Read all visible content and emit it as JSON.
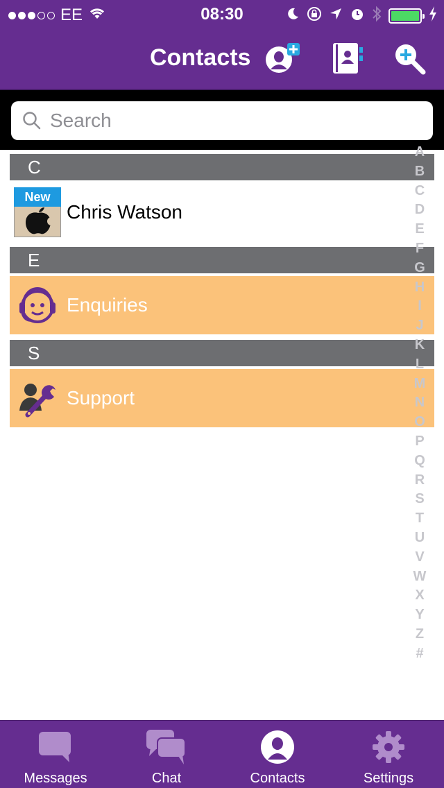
{
  "status_bar": {
    "carrier": "EE",
    "time": "08:30"
  },
  "nav": {
    "title": "Contacts"
  },
  "search": {
    "placeholder": "Search"
  },
  "sections": [
    {
      "letter": "C",
      "contacts": [
        {
          "name": "Chris Watson",
          "badge": "New"
        }
      ]
    },
    {
      "letter": "E",
      "contacts": [
        {
          "name": "Enquiries"
        }
      ]
    },
    {
      "letter": "S",
      "contacts": [
        {
          "name": "Support"
        }
      ]
    }
  ],
  "index_letters": [
    "A",
    "B",
    "C",
    "D",
    "E",
    "F",
    "G",
    "H",
    "I",
    "J",
    "K",
    "L",
    "M",
    "N",
    "O",
    "P",
    "Q",
    "R",
    "S",
    "T",
    "U",
    "V",
    "W",
    "X",
    "Y",
    "Z",
    "#"
  ],
  "tabs": [
    {
      "label": "Messages",
      "icon": "speech-bubble-icon"
    },
    {
      "label": "Chat",
      "icon": "chat-bubbles-icon"
    },
    {
      "label": "Contacts",
      "icon": "contact-person-icon",
      "active": true
    },
    {
      "label": "Settings",
      "icon": "gear-icon"
    }
  ],
  "colors": {
    "brand_purple": "#652d90",
    "section_gray": "#6d6e71",
    "service_orange": "#fbc27a",
    "badge_blue": "#1e9ae0",
    "battery_green": "#4cd964"
  }
}
